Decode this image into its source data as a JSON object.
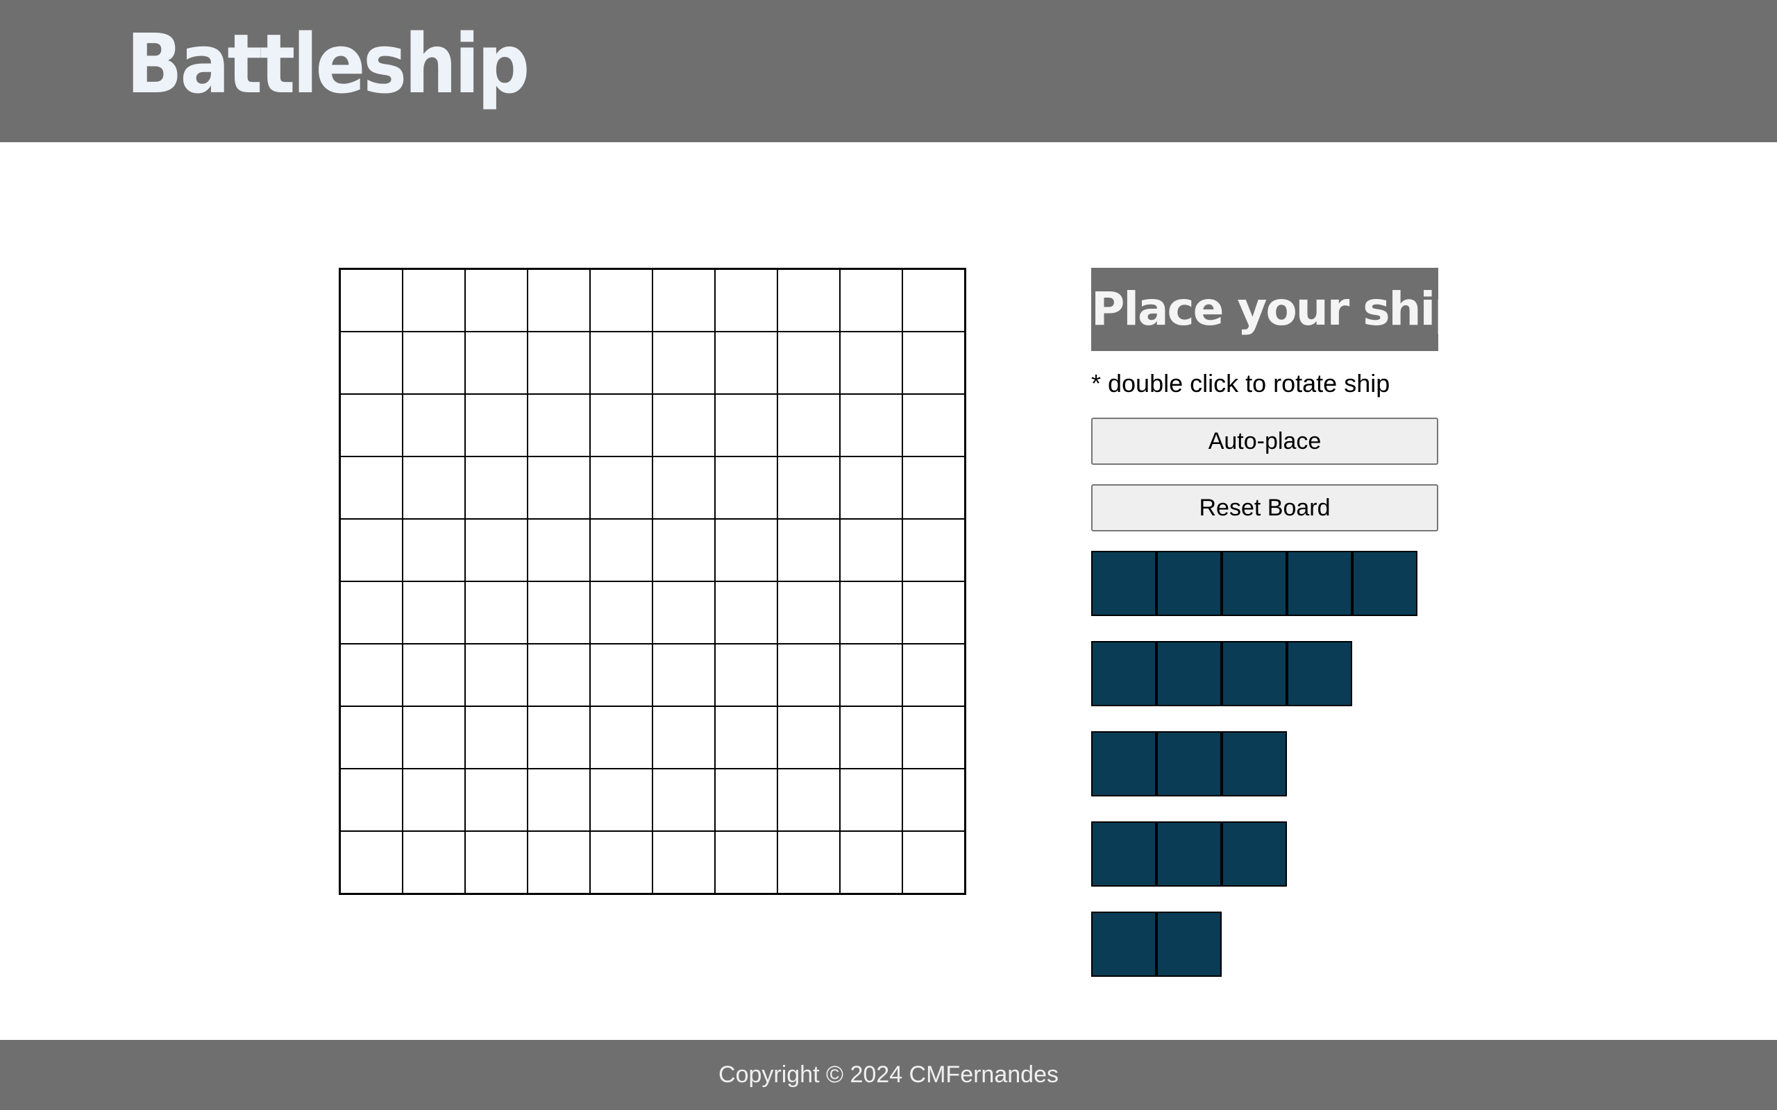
{
  "header": {
    "title": "Battleship"
  },
  "board": {
    "rows": 10,
    "cols": 10
  },
  "panel": {
    "title": "Place your ships",
    "hint": "* double click to rotate ship",
    "auto_place_label": "Auto-place",
    "reset_label": "Reset Board"
  },
  "fleet": {
    "ship_lengths": [
      5,
      4,
      3,
      3,
      2
    ],
    "ship_color": "#0b3c55"
  },
  "colors": {
    "header_bg": "#6f6f6f",
    "title_text": "#eef3fa",
    "ship": "#0b3c55"
  },
  "footer": {
    "copyright": "Copyright © 2024 CMFernandes"
  }
}
